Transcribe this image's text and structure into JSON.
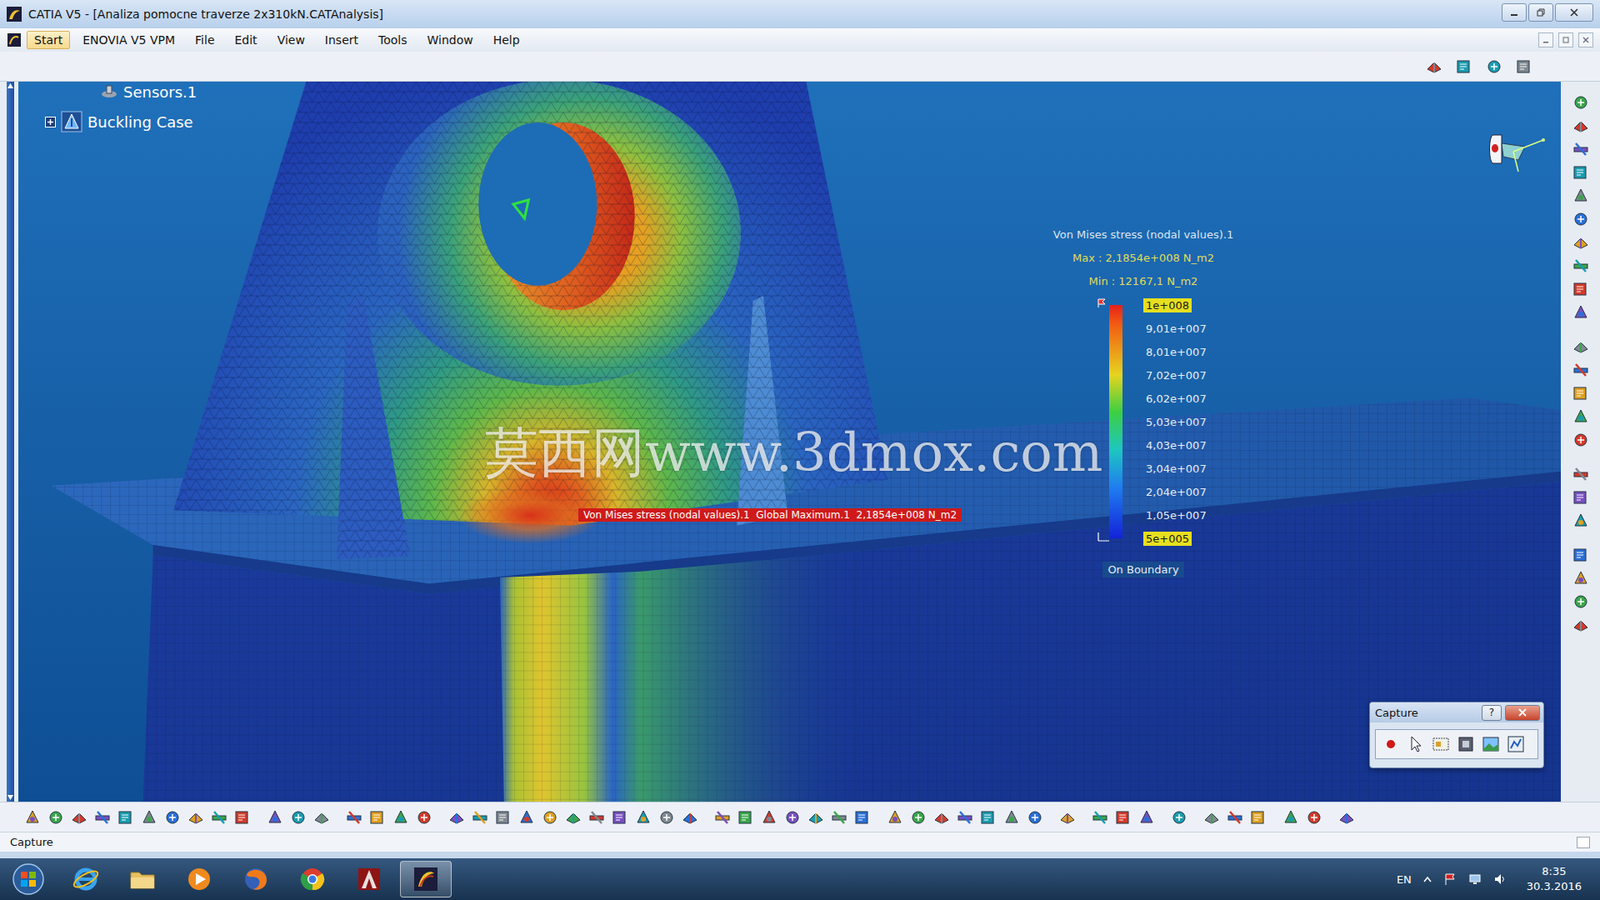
{
  "window": {
    "title": "CATIA V5 - [Analiza pomocne traverze 2x310kN.CATAnalysis]"
  },
  "menu": [
    {
      "label": "Start",
      "selected": true
    },
    {
      "label": "ENOVIA V5 VPM",
      "selected": false
    },
    {
      "label": "File",
      "selected": false
    },
    {
      "label": "Edit",
      "selected": false
    },
    {
      "label": "View",
      "selected": false
    },
    {
      "label": "Insert",
      "selected": false
    },
    {
      "label": "Tools",
      "selected": false
    },
    {
      "label": "Window",
      "selected": false
    },
    {
      "label": "Help",
      "selected": false
    }
  ],
  "tree": [
    {
      "label": "Sensors.1",
      "kind": "sensor",
      "expanded": false
    },
    {
      "label": "Buckling Case",
      "kind": "case",
      "expanded": false
    }
  ],
  "legend": {
    "title": "Von Mises stress (nodal values).1",
    "max": "Max : 2,1854e+008 N_m2",
    "min": "Min : 12167,1 N_m2",
    "ticks": [
      {
        "label": "1e+008",
        "highlighted": true
      },
      {
        "label": "9,01e+007",
        "highlighted": false
      },
      {
        "label": "8,01e+007",
        "highlighted": false
      },
      {
        "label": "7,02e+007",
        "highlighted": false
      },
      {
        "label": "6,02e+007",
        "highlighted": false
      },
      {
        "label": "5,03e+007",
        "highlighted": false
      },
      {
        "label": "4,03e+007",
        "highlighted": false
      },
      {
        "label": "3,04e+007",
        "highlighted": false
      },
      {
        "label": "2,04e+007",
        "highlighted": false
      },
      {
        "label": "1,05e+007",
        "highlighted": false
      },
      {
        "label": "5e+005",
        "highlighted": true
      }
    ],
    "mode": "On Boundary"
  },
  "marker": {
    "text": "Von Mises stress (nodal values).1  Global Maximum.1  2,1854e+008 N_m2"
  },
  "watermark": "莫西网www.3dmox.com",
  "capture": {
    "title": "Capture",
    "help": "?"
  },
  "status_bar": {
    "text": "Capture"
  },
  "taskbar": {
    "language": "EN",
    "time": "8:35",
    "date": "30.3.2016",
    "apps": [
      {
        "kind": "ie",
        "active": false
      },
      {
        "kind": "folder",
        "active": false
      },
      {
        "kind": "media",
        "active": false
      },
      {
        "kind": "firefox",
        "active": false
      },
      {
        "kind": "chrome",
        "active": false
      },
      {
        "kind": "autocad",
        "active": false
      },
      {
        "kind": "catia",
        "active": true
      }
    ]
  }
}
